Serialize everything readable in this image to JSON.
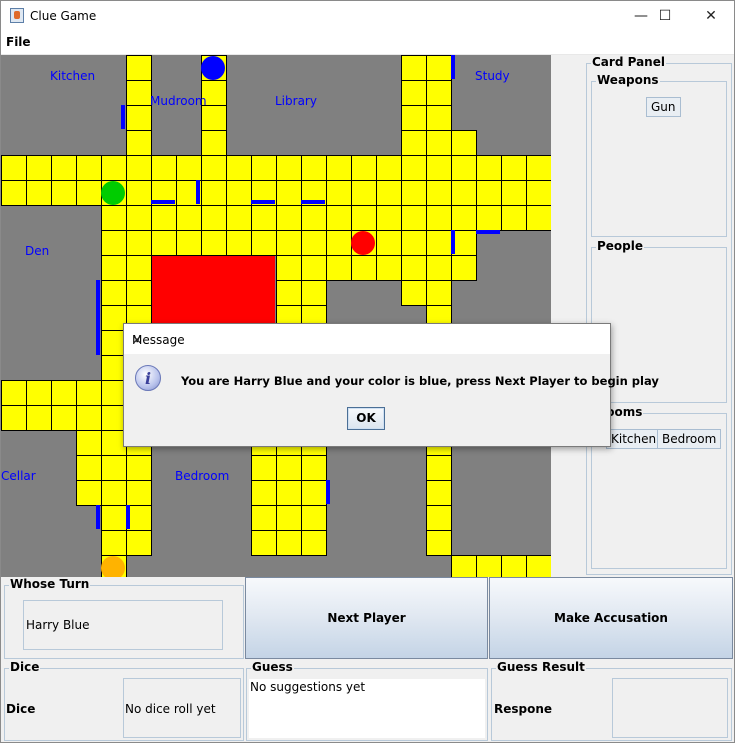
{
  "window": {
    "title": "Clue Game",
    "minimize_label": "—",
    "maximize_label": "☐",
    "close_label": "✕"
  },
  "menu": {
    "file": "File"
  },
  "board": {
    "rooms": {
      "kitchen": "Kitchen",
      "mudroom": "Mudroom",
      "library": "Library",
      "study": "Study",
      "den": "Den",
      "cellar": "Cellar",
      "bedroom": "Bedroom"
    },
    "colors": {
      "floor": "#808080",
      "hall": "#ffff00",
      "door": "#0000ff",
      "label": "#0000ff",
      "highlight": "#ff0000"
    },
    "tokens": [
      {
        "name": "blue-player-token",
        "color": "#0000ff"
      },
      {
        "name": "green-player-token",
        "color": "#00cc00"
      },
      {
        "name": "red-player-token",
        "color": "#ff0000"
      },
      {
        "name": "orange-player-token",
        "color": "#ffb300"
      }
    ]
  },
  "card_panel": {
    "title": "Card Panel",
    "weapons": {
      "title": "Weapons",
      "cards": [
        "Gun"
      ]
    },
    "people": {
      "title": "People",
      "cards": []
    },
    "rooms": {
      "title": "Rooms",
      "cards": [
        "Kitchen",
        "Bedroom"
      ]
    }
  },
  "whose_turn": {
    "title": "Whose Turn",
    "value": "Harry Blue"
  },
  "buttons": {
    "next_player": "Next Player",
    "make_accusation": "Make Accusation"
  },
  "dice": {
    "title": "Dice",
    "label": "Dice",
    "value": "No dice roll yet"
  },
  "guess": {
    "title": "Guess",
    "value": "No suggestions yet"
  },
  "guess_result": {
    "title": "Guess Result",
    "label": "Respone",
    "value": ""
  },
  "dialog": {
    "title": "Message",
    "close_label": "✕",
    "icon": "information-icon",
    "message": "You are Harry Blue and your color is blue, press Next Player to begin play",
    "ok_label": "OK"
  }
}
